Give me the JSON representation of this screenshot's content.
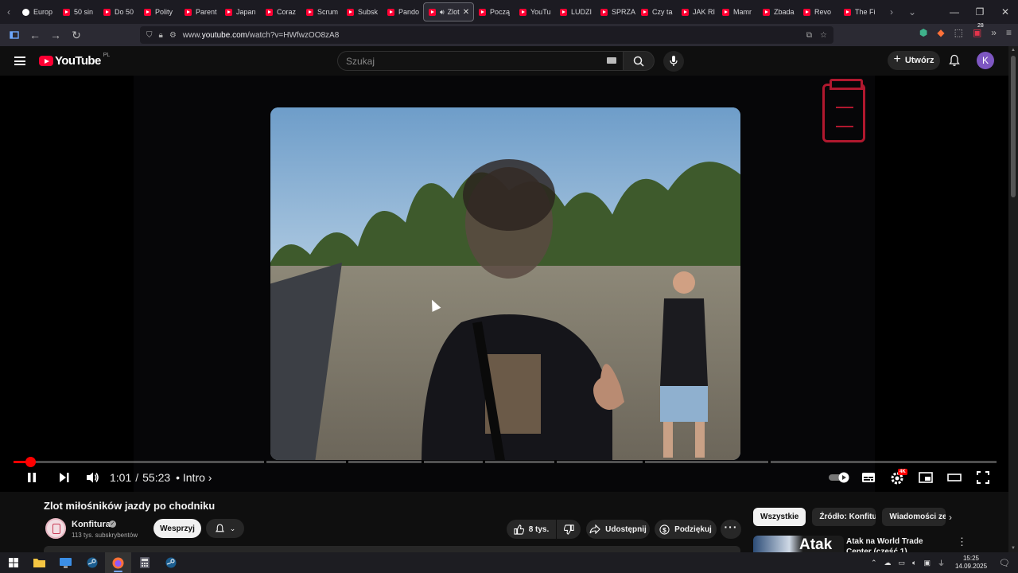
{
  "browser": {
    "tabs": [
      {
        "label": "Europ",
        "icon": "globe-icon",
        "active": false
      },
      {
        "label": "50 sin",
        "icon": "youtube-icon",
        "active": false
      },
      {
        "label": "Do 50",
        "icon": "youtube-icon",
        "active": false
      },
      {
        "label": "Polity",
        "icon": "youtube-icon",
        "active": false
      },
      {
        "label": "Parent",
        "icon": "youtube-icon",
        "active": false
      },
      {
        "label": "Japan",
        "icon": "youtube-icon",
        "active": false
      },
      {
        "label": "Coraz",
        "icon": "youtube-icon",
        "active": false
      },
      {
        "label": "Scrum",
        "icon": "youtube-icon",
        "active": false
      },
      {
        "label": "Subsk",
        "icon": "youtube-icon",
        "active": false
      },
      {
        "label": "Pando",
        "icon": "youtube-icon",
        "active": false
      },
      {
        "label": "Zlot",
        "icon": "youtube-icon",
        "active": true
      },
      {
        "label": "Począ",
        "icon": "youtube-icon",
        "active": false
      },
      {
        "label": "YouTu",
        "icon": "youtube-icon",
        "active": false
      },
      {
        "label": "LUDZI",
        "icon": "youtube-icon",
        "active": false
      },
      {
        "label": "SPRZA",
        "icon": "youtube-icon",
        "active": false
      },
      {
        "label": "Czy ta",
        "icon": "youtube-icon",
        "active": false
      },
      {
        "label": "JAK RI",
        "icon": "youtube-icon",
        "active": false
      },
      {
        "label": "Mamr",
        "icon": "youtube-icon",
        "active": false
      },
      {
        "label": "Zbada",
        "icon": "youtube-icon",
        "active": false
      },
      {
        "label": "Revo",
        "icon": "youtube-icon",
        "active": false
      },
      {
        "label": "The Fi",
        "icon": "youtube-icon",
        "active": false
      }
    ],
    "url_prefix": "www.",
    "url_domain": "youtube.com",
    "url_rest": "/watch?v=HWfwzOO8zA8",
    "extension_badge": "28"
  },
  "youtube": {
    "logo_text": "YouTube",
    "country_code": "PL",
    "search_placeholder": "Szukaj",
    "create_label": "Utwórz",
    "avatar_letter": "K"
  },
  "player": {
    "current_time": "1:01",
    "duration": "55:23",
    "time_separator": "/",
    "chapter": "Intro",
    "progress_fraction": 0.017,
    "chapter_marks": [
      0.255,
      0.338,
      0.415,
      0.477,
      0.55,
      0.64,
      0.768
    ],
    "quality_badge": "4K",
    "accent_color": "#ff0000"
  },
  "video": {
    "title": "Zlot miłośników jazdy po chodniku",
    "channel_name": "Konfitura",
    "subscribers": "113 tys. subskrybentów",
    "support_label": "Wesprzyj",
    "likes": "8 tys.",
    "share_label": "Udostępnij",
    "thanks_label": "Podziękuj"
  },
  "sidebar": {
    "chips": [
      {
        "label": "Wszystkie",
        "active": true
      },
      {
        "label": "Źródło: Konfitura",
        "active": false
      },
      {
        "label": "Wiadomości ze",
        "active": false
      }
    ],
    "recommendation": {
      "thumb_text": "Atak",
      "title": "Atak na World Trade Center (część 1)"
    }
  },
  "taskbar": {
    "time": "15:25",
    "date": "14.09.2025"
  }
}
